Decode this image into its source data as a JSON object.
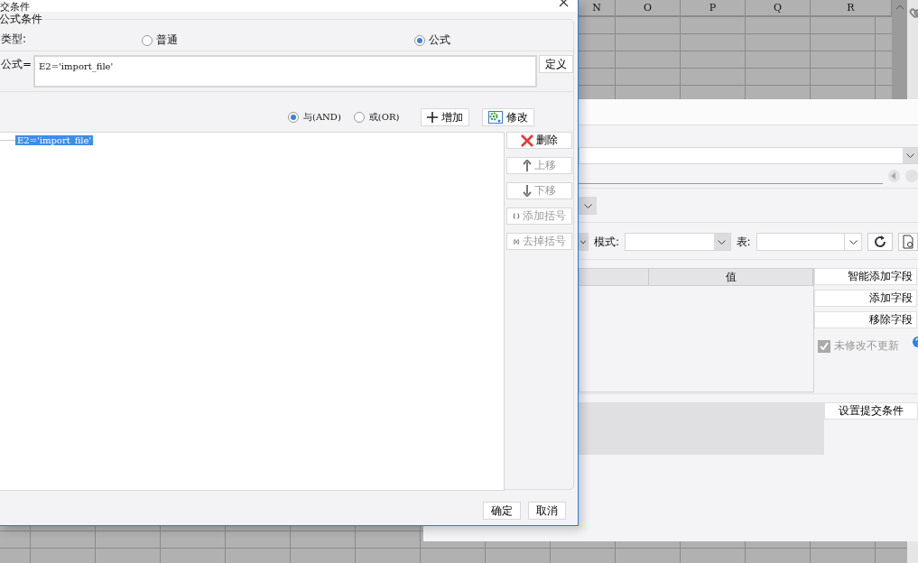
{
  "spreadsheet": {
    "columns": [
      "N",
      "O",
      "P",
      "Q",
      "R"
    ]
  },
  "background_panel": {
    "mode_label": "模式:",
    "table_label": "表:",
    "value_column": "值",
    "field_buttons": [
      "智能添加字段",
      "添加字段",
      "移除字段"
    ],
    "skip_unchanged": {
      "label": "未修改不更新",
      "checked": true,
      "disabled": true
    },
    "submit_condition_button": "设置提交条件"
  },
  "dialog": {
    "title": "交条件",
    "group_title": "公式条件",
    "type_label": "类型:",
    "type_options": [
      {
        "label": "普通",
        "selected": false
      },
      {
        "label": "公式",
        "selected": true
      }
    ],
    "formula_label": "公式=",
    "formula_value": "E2='import_file'",
    "define_button": "定义",
    "logic_options": [
      {
        "label": "与(AND)",
        "selected": true
      },
      {
        "label": "或(OR)",
        "selected": false
      }
    ],
    "add_button": "增加",
    "edit_button": "修改",
    "conditions": [
      {
        "text": "E2='import_file'",
        "selected": true
      }
    ],
    "side_buttons": [
      {
        "kind": "delete",
        "label": "删除",
        "disabled": false
      },
      {
        "kind": "up",
        "label": "上移",
        "disabled": true
      },
      {
        "kind": "down",
        "label": "下移",
        "disabled": true
      },
      {
        "kind": "add_paren",
        "label": "添加括号",
        "disabled": true
      },
      {
        "kind": "remove_paren",
        "label": "去掉括号",
        "disabled": true
      }
    ],
    "ok_button": "确定",
    "cancel_button": "取消"
  }
}
